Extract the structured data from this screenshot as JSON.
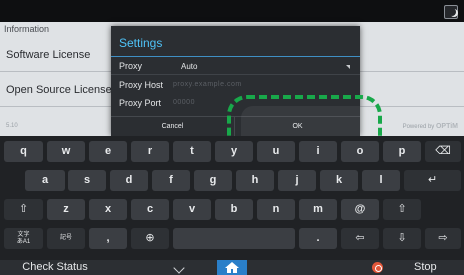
{
  "page": {
    "section": "Information",
    "rows": [
      "Software License",
      "Open Source Licenses"
    ],
    "version": "5.10",
    "powered_prefix": "Powered by",
    "powered_brand": "OPTiM"
  },
  "dialog": {
    "title": "Settings",
    "rows": [
      {
        "label": "Proxy",
        "value": "Auto"
      },
      {
        "label": "Proxy Host",
        "value": "proxy.example.com"
      },
      {
        "label": "Proxy Port",
        "value": "00000"
      }
    ],
    "cancel": "Cancel",
    "ok": "OK"
  },
  "keyboard": {
    "row1": [
      "q",
      "w",
      "e",
      "r",
      "t",
      "y",
      "u",
      "i",
      "o",
      "p",
      "⌫"
    ],
    "row2": [
      "a",
      "s",
      "d",
      "f",
      "g",
      "h",
      "j",
      "k",
      "l",
      "↵"
    ],
    "row3": [
      "⇧",
      "z",
      "x",
      "c",
      "v",
      "b",
      "n",
      "m",
      "@",
      "⇧"
    ],
    "row4": [
      "文字\nあA1",
      "記号",
      ",",
      "⊕",
      "",
      ".",
      "⇦",
      "⇩",
      "⇨"
    ]
  },
  "bottom": {
    "check_status": "Check Status",
    "stop": "Stop"
  },
  "colors": {
    "accent": "#4fc3f7",
    "highlight": "#18a84a",
    "home": "#2a7fc9",
    "stop": "#e2573a"
  }
}
